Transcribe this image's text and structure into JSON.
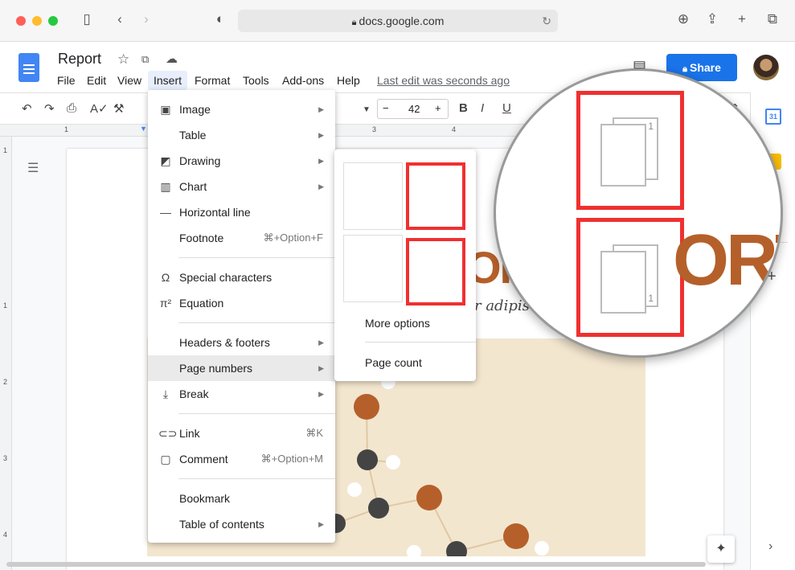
{
  "browser": {
    "url": "docs.google.com"
  },
  "doc": {
    "title": "Report",
    "menus": [
      "File",
      "Edit",
      "View",
      "Insert",
      "Format",
      "Tools",
      "Add-ons",
      "Help"
    ],
    "last_edit": "Last edit was seconds ago",
    "share_label": "Share",
    "font_size": "42",
    "page_text_fragment": "r adipis",
    "page_title_fragment": "OR",
    "magnified_title_fragment": "ORT"
  },
  "ruler": {
    "h": [
      "1",
      "1",
      "2",
      "3",
      "4"
    ],
    "v": [
      "1",
      "1",
      "2",
      "3",
      "4"
    ]
  },
  "insert_menu": {
    "items": [
      {
        "label": "Image",
        "icon": "image-icon",
        "arrow": true
      },
      {
        "label": "Table",
        "icon": "",
        "arrow": true
      },
      {
        "label": "Drawing",
        "icon": "drawing-icon",
        "arrow": true
      },
      {
        "label": "Chart",
        "icon": "chart-icon",
        "arrow": true
      },
      {
        "label": "Horizontal line",
        "icon": "horizontal-line-icon"
      },
      {
        "label": "Footnote",
        "icon": "",
        "shortcut": "⌘+Option+F"
      },
      {
        "label": "Special characters",
        "icon": "omega-icon"
      },
      {
        "label": "Equation",
        "icon": "pi-icon"
      },
      {
        "label": "Headers & footers",
        "icon": "",
        "arrow": true
      },
      {
        "label": "Page numbers",
        "icon": "",
        "arrow": true,
        "active": true
      },
      {
        "label": "Break",
        "icon": "break-icon",
        "arrow": true
      },
      {
        "label": "Link",
        "icon": "link-icon",
        "shortcut": "⌘K"
      },
      {
        "label": "Comment",
        "icon": "comment-icon",
        "shortcut": "⌘+Option+M"
      },
      {
        "label": "Bookmark",
        "icon": ""
      },
      {
        "label": "Table of contents",
        "icon": "",
        "arrow": true
      }
    ]
  },
  "page_numbers_menu": {
    "options": [
      "1",
      "2"
    ],
    "more_options": "More options",
    "page_count": "Page count"
  },
  "colors": {
    "accent": "#1a73e8",
    "highlight": "#f03030",
    "title_orange": "#b5602a"
  }
}
